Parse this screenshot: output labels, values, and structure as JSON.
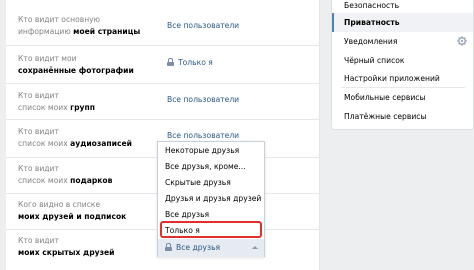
{
  "privacy": {
    "rows": [
      {
        "q1": "Кто видит основную",
        "q2a": "информацию ",
        "q2b": "моей страницы",
        "value": "Все пользователи"
      },
      {
        "q1": "Кто видит мои",
        "q2a": "",
        "q2b": "сохранённые фотографии",
        "value": "Только я"
      },
      {
        "q1": "Кто видит",
        "q2a": "список моих ",
        "q2b": "групп",
        "value": "Все пользователи"
      },
      {
        "q1": "Кто видит",
        "q2a": "список моих ",
        "q2b": "аудиозаписей",
        "value": "Все пользователи"
      },
      {
        "q1": "Кто видит",
        "q2a": "список моих ",
        "q2b": "подарков",
        "value": ""
      },
      {
        "q1": "Кого видно в списке",
        "q2a": "",
        "q2b": "моих друзей и подписок",
        "value": ""
      },
      {
        "q1": "Кто видит",
        "q2a": "",
        "q2b": "моих скрытых друзей",
        "value": "Все друзья"
      }
    ]
  },
  "dropdown": {
    "items": [
      "Некоторые друзья",
      "Все друзья, кроме...",
      "Скрытые друзья",
      "Друзья и друзья друзей",
      "Все друзья",
      "Только я"
    ],
    "selected": "Все друзья"
  },
  "menu": {
    "items": [
      "Безопасность",
      "Приватность",
      "Уведомления",
      "Чёрный список",
      "Настройки приложений",
      "Мобильные сервисы",
      "Платёжные сервисы"
    ],
    "active": "Приватность"
  },
  "colors": {
    "accent": "#5181b8",
    "link": "#2a5885",
    "highlight": "#e0302a"
  }
}
